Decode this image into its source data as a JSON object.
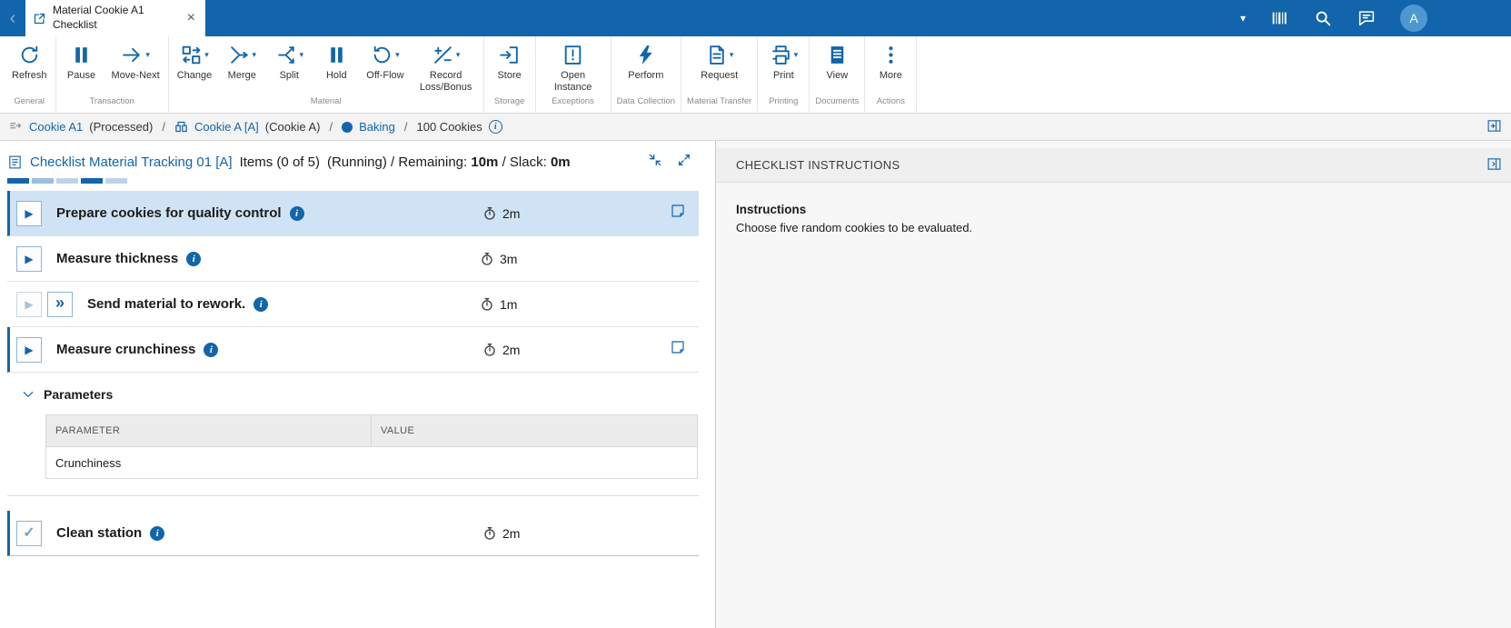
{
  "colors": {
    "accent": "#1265ab",
    "topbar": "#1265ab",
    "selected_row_bg": "#cfe3f4",
    "avatar_bg": "#4f97cf"
  },
  "topbar": {
    "tab": {
      "line1": "Material Cookie A1",
      "line2": "Checklist"
    },
    "avatar": "A"
  },
  "toolbar": {
    "groups": [
      {
        "label": "General",
        "buttons": [
          {
            "label": "Refresh"
          }
        ]
      },
      {
        "label": "Transaction",
        "buttons": [
          {
            "label": "Pause"
          },
          {
            "label": "Move-Next"
          }
        ]
      },
      {
        "label": "Material",
        "buttons": [
          {
            "label": "Change"
          },
          {
            "label": "Merge"
          },
          {
            "label": "Split"
          },
          {
            "label": "Hold"
          },
          {
            "label": "Off-Flow"
          },
          {
            "label": "Record Loss/Bonus"
          }
        ]
      },
      {
        "label": "Storage",
        "buttons": [
          {
            "label": "Store"
          }
        ]
      },
      {
        "label": "Exceptions",
        "buttons": [
          {
            "label": "Open Instance"
          }
        ]
      },
      {
        "label": "Data Collection",
        "buttons": [
          {
            "label": "Perform"
          }
        ]
      },
      {
        "label": "Material Transfer",
        "buttons": [
          {
            "label": "Request"
          }
        ]
      },
      {
        "label": "Printing",
        "buttons": [
          {
            "label": "Print"
          }
        ]
      },
      {
        "label": "Documents",
        "buttons": [
          {
            "label": "View"
          }
        ]
      },
      {
        "label": "Actions",
        "buttons": [
          {
            "label": "More"
          }
        ]
      }
    ]
  },
  "breadcrumb": {
    "separator": "/",
    "material_link": "Cookie A1",
    "material_suffix": "(Processed)",
    "entity_link": "Cookie A [A]",
    "entity_suffix": "(Cookie A)",
    "operation_link": "Baking",
    "quantity": "100 Cookies"
  },
  "checklist": {
    "title": "Checklist Material Tracking 01 [A]",
    "items_count": "Items (0 of 5)",
    "status_prefix": "(Running) / Remaining:",
    "remaining": "10m",
    "slack_label": "/ Slack:",
    "slack": "0m",
    "progress_segments": [
      "#1265ab",
      "#9dbedd",
      "#bcd3e8",
      "#1265ab",
      "#bcd3e8"
    ],
    "items": [
      {
        "title": "Prepare cookies for quality control",
        "duration": "2m"
      },
      {
        "title": "Measure thickness",
        "duration": "3m"
      },
      {
        "title": "Send material to rework.",
        "duration": "1m"
      },
      {
        "title": "Measure crunchiness",
        "duration": "2m"
      },
      {
        "title": "Clean station",
        "duration": "2m"
      }
    ],
    "parameters": {
      "label": "Parameters",
      "columns": [
        "PARAMETER",
        "VALUE"
      ],
      "rows": [
        {
          "parameter": "Crunchiness",
          "value": ""
        }
      ]
    }
  },
  "instructions_panel": {
    "header": "CHECKLIST INSTRUCTIONS",
    "heading": "Instructions",
    "body": "Choose five random cookies to be evaluated."
  }
}
